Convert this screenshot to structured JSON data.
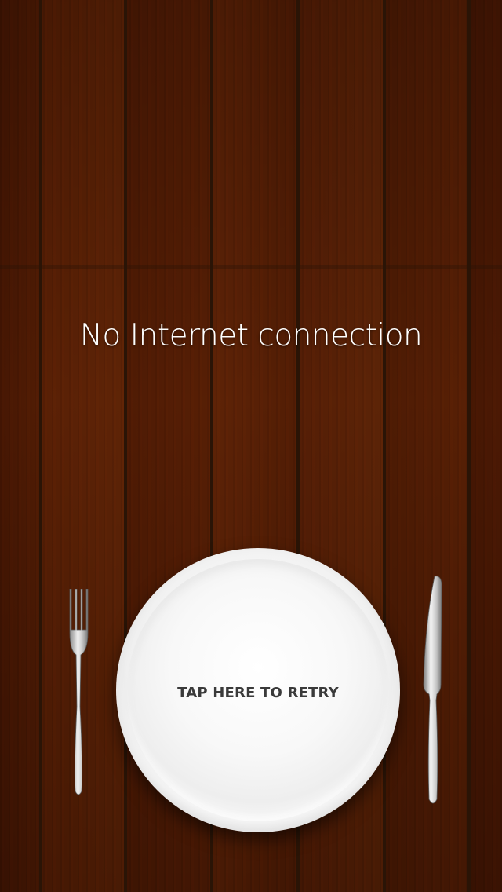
{
  "screen": {
    "message": "No Internet connection",
    "retry_label": "TAP HERE TO RETRY"
  },
  "icons": {
    "fork": "fork-icon",
    "knife": "knife-icon",
    "plate": "plate"
  },
  "colors": {
    "message_text": "#ffffff",
    "retry_text": "#3a3a3a",
    "wood": "#8a4f1f",
    "plate": "#f6f6f6"
  }
}
